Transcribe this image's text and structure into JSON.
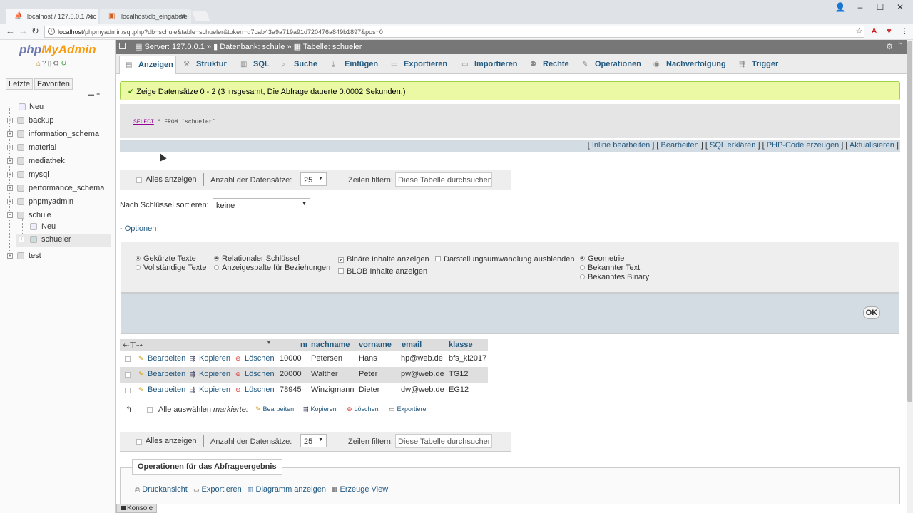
{
  "browser": {
    "tabs": [
      {
        "label": "localhost / 127.0.0.1 / sc"
      },
      {
        "label": "localhost/db_eingabe/ei"
      }
    ],
    "url_host": "localhost",
    "url_rest": "/phpmyadmin/sql.php?db=schule&table=schueler&token=d7cab43a9a719a91d720476a849b1897&pos=0"
  },
  "sidebar": {
    "logo_php": "php",
    "logo_my": "My",
    "logo_admin": "Admin",
    "recent_tab": "Letzte",
    "favorites_tab": "Favoriten",
    "tree": [
      {
        "label": "Neu"
      },
      {
        "label": "backup"
      },
      {
        "label": "information_schema"
      },
      {
        "label": "material"
      },
      {
        "label": "mediathek"
      },
      {
        "label": "mysql"
      },
      {
        "label": "performance_schema"
      },
      {
        "label": "phpmyadmin"
      },
      {
        "label": "schule"
      },
      {
        "label": "Neu"
      },
      {
        "label": "schueler"
      },
      {
        "label": "test"
      }
    ]
  },
  "breadcrumb": {
    "server": "Server: 127.0.0.1",
    "database": "Datenbank: schule",
    "table": "Tabelle: schueler",
    "sep": "»"
  },
  "menu": {
    "tabs": [
      {
        "label": "Anzeigen"
      },
      {
        "label": "Struktur"
      },
      {
        "label": "SQL"
      },
      {
        "label": "Suche"
      },
      {
        "label": "Einfügen"
      },
      {
        "label": "Exportieren"
      },
      {
        "label": "Importieren"
      },
      {
        "label": "Rechte"
      },
      {
        "label": "Operationen"
      },
      {
        "label": "Nachverfolgung"
      },
      {
        "label": "Trigger"
      }
    ]
  },
  "message": {
    "success": "Zeige Datensätze 0 - 2 (3 insgesamt, Die Abfrage dauerte 0.0002 Sekunden.)"
  },
  "sql": {
    "keyword": "SELECT",
    "rest": " * FROM `schueler`",
    "actions": [
      {
        "label": "Inline bearbeiten"
      },
      {
        "label": "Bearbeiten"
      },
      {
        "label": "SQL erklären"
      },
      {
        "label": "PHP-Code erzeugen"
      },
      {
        "label": "Aktualisieren"
      }
    ]
  },
  "navigation": {
    "show_all": "Alles anzeigen",
    "num_rows_label": "Anzahl der Datensätze:",
    "num_rows_value": "25",
    "filter_label": "Zeilen filtern:",
    "filter_placeholder": "Diese Tabelle durchsuchen"
  },
  "sort": {
    "label": "Nach Schlüssel sortieren:",
    "value": "keine"
  },
  "options": {
    "link": "- Optionen",
    "partial_texts": "Gekürzte Texte",
    "full_texts": "Vollständige Texte",
    "relational_key": "Relationaler Schlüssel",
    "display_column": "Anzeigespalte für Beziehungen",
    "show_binary": "Binäre Inhalte anzeigen",
    "show_blob": "BLOB Inhalte anzeigen",
    "hide_transform": "Darstellungsumwandlung ausblenden",
    "geometry": "Geometrie",
    "wkt": "Bekannter Text",
    "wkb": "Bekanntes Binary",
    "ok": "OK"
  },
  "results": {
    "columns": [
      "nr",
      "nachname",
      "vorname",
      "email",
      "klasse"
    ],
    "action_edit": "Bearbeiten",
    "action_copy": "Kopieren",
    "action_delete": "Löschen",
    "rows": [
      [
        "10000",
        "Petersen",
        "Hans",
        "hp@web.de",
        "bfs_ki2017"
      ],
      [
        "20000",
        "Walther",
        "Peter",
        "pw@web.de",
        "TG12"
      ],
      [
        "78945",
        "Winzigmann",
        "Dieter",
        "dw@web.de",
        "EG12"
      ]
    ]
  },
  "bulk": {
    "select_all": "Alle auswählen",
    "marked": "markierte:",
    "edit": "Bearbeiten",
    "copy": "Kopieren",
    "delete": "Löschen",
    "export": "Exportieren"
  },
  "query_ops": {
    "title": "Operationen für das Abfrageergebnis",
    "print": "Druckansicht",
    "export": "Exportieren",
    "chart": "Diagramm anzeigen",
    "view": "Erzeuge View"
  },
  "console": {
    "label": "Konsole"
  },
  "colors": {
    "link": "#235a81",
    "success_bg": "#ebf8a4",
    "topbar": "#777777"
  }
}
